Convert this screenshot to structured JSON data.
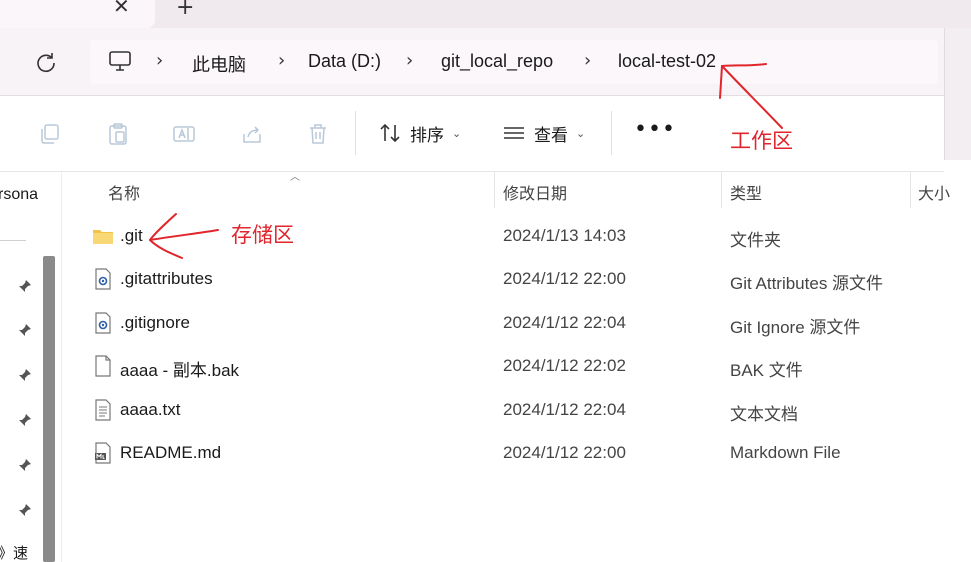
{
  "tabs": {
    "close_glyph": "✕",
    "new_tab_glyph": "+"
  },
  "breadcrumb": {
    "items": [
      "此电脑",
      "Data (D:)",
      "git_local_repo",
      "local-test-02"
    ],
    "separator": "›"
  },
  "toolbar": {
    "sort_label": "排序",
    "view_label": "查看",
    "more_glyph": "•••"
  },
  "nav": {
    "clipped_label": "rsona",
    "bottom_label": "》速"
  },
  "columns": {
    "name": "名称",
    "modified": "修改日期",
    "type": "类型",
    "size": "大小"
  },
  "files": [
    {
      "name": ".git",
      "modified": "2024/1/13 14:03",
      "type": "文件夹",
      "icon": "folder-icon"
    },
    {
      "name": ".gitattributes",
      "modified": "2024/1/12 22:00",
      "type": "Git Attributes 源文件",
      "icon": "settings-file-icon"
    },
    {
      "name": ".gitignore",
      "modified": "2024/1/12 22:04",
      "type": "Git Ignore 源文件",
      "icon": "settings-file-icon"
    },
    {
      "name": "aaaa - 副本.bak",
      "modified": "2024/1/12 22:02",
      "type": "BAK 文件",
      "icon": "blank-file-icon"
    },
    {
      "name": "aaaa.txt",
      "modified": "2024/1/12 22:04",
      "type": "文本文档",
      "icon": "text-file-icon"
    },
    {
      "name": "README.md",
      "modified": "2024/1/12 22:00",
      "type": "Markdown File",
      "icon": "markdown-file-icon"
    }
  ],
  "annotations": {
    "workspace": "工作区",
    "repository": "存储区"
  },
  "colors": {
    "annotation": "#e0252c",
    "folder": "#f3c24b",
    "accent": "#0067c0"
  }
}
